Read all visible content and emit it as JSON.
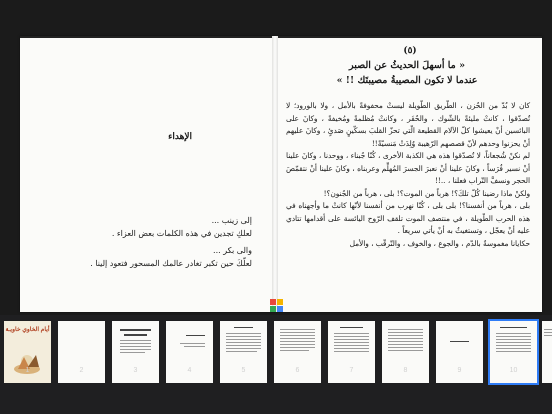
{
  "left_page": {
    "dedication_title": "الإهداء",
    "lines": [
      "إلى زينب ...",
      "لعلكِ تجدين في هذه الكلمات بعض العزاء .",
      "والى بكر ...",
      "لعلّكَ حين تكبر تغادر عالمك المسحور فتعود إلينا ."
    ]
  },
  "right_page": {
    "chapter_number": "(٥)",
    "chapter_title_line1": "« ما أسهلَ الحديثُ عن الصبر",
    "chapter_title_line2": "عندما لا تكون المصيبةُ مصيبتَك !! »",
    "paragraphs": [
      "كان لا بُدّ من الحُزن ، الطّريق الطّويلة ليستْ محفوفةً بالأمل ، ولا بالورود؛ لا تُصدّقوا ، كانتْ مليئةً بالشّوك ، والحُفَر ، وكانتْ مُظلمةً ومُخيفةً ، وكانَ على البائسين أنْ يعيشوا كلّ الآلام القطيعة الّتي تحزّ القلبَ بسكّينٍ صَدئٍ ، وكانَ عليهم أنْ يحزنوا وحدهم لأنّ قصصهم الرّهيبة وُلِدَتْ مَنسيّةً!!",
      "لم نكنْ شُجعاناً، لا تُصدّقوا هذه هي الكذبة الأخرى ، كُنّا جُبناء ، ووحدنا ، وكانَ علينا أنْ نسير فُرَساً ، وكانَ علينا أنْ نعبرَ الجسرَ المُهلِّم وعربناه ، وكانَ علينا أنْ نتقمّصَ الحجر ونسفَّ التّراب فعلنا ، ..!!",
      "ولكنْ ماذا رضينا كُلّ تلكَ؟! هرباً من الموت؟! بلى ، هرباً من الجُنون؟!",
      "بلى ، هرباً من أنفسنا؟! بلى بلى ، كُنّا نهرب من أنفسنا لأنّها كانتْ ما وأجهناه في هذه الحرب الطّويلة ، في منتصف الموت تلقف الرّوح اليائسة على أقدامها تتادي عليه أنْ يعجّل ، وتستغيثُ به أنْ يأتي سريعاً .",
      "حكايانا مغموسةٌ بالدّم ، والجوع ، والخوف ، والتّرقّب ، والأمل"
    ]
  },
  "thumbnails": [
    {
      "number": "1",
      "cover_title": "أيام الخاوي خاويـة"
    },
    {
      "number": "2"
    },
    {
      "number": "3"
    },
    {
      "number": "4"
    },
    {
      "number": "5"
    },
    {
      "number": "6"
    },
    {
      "number": "7"
    },
    {
      "number": "8"
    },
    {
      "number": "9"
    },
    {
      "number": "10"
    },
    {
      "number": ""
    }
  ],
  "colors": {
    "background": "#1b1b1b",
    "paper": "#fbfbf9",
    "selected_outline": "#2f7cf6",
    "loader": [
      "#e8483b",
      "#f5b400",
      "#34a853",
      "#4285f4"
    ]
  }
}
